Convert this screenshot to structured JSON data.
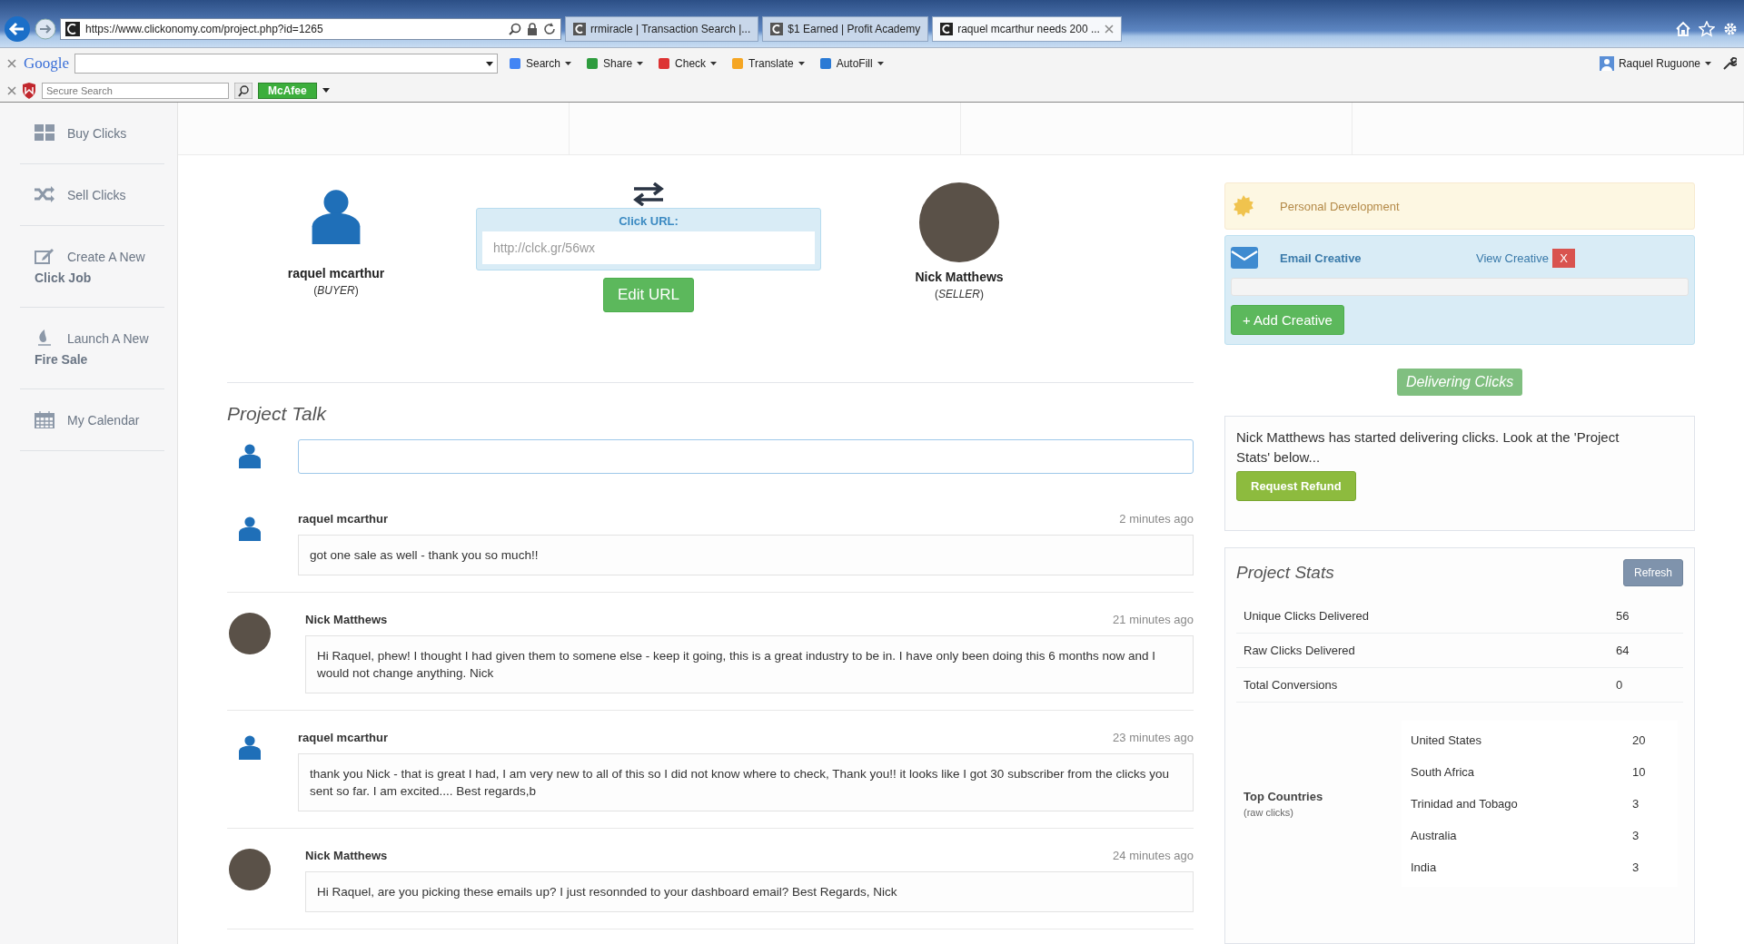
{
  "browser": {
    "url": "https://www.clickonomy.com/project.php?id=1265",
    "tabs": [
      {
        "title": "rrmiracle | Transaction Search |...",
        "selected": false
      },
      {
        "title": "$1 Earned | Profit Academy",
        "selected": false
      },
      {
        "title": "raquel mcarthur needs 200 ...",
        "selected": true
      }
    ],
    "toolbar": {
      "brand": "Google",
      "buttons": [
        "Search",
        "Share",
        "Check",
        "Translate",
        "AutoFill"
      ],
      "user": "Raquel Ruguone"
    },
    "security_bar": {
      "placeholder": "Secure Search",
      "badge": "McAfee"
    }
  },
  "sidebar": {
    "items": [
      {
        "kind": "grid",
        "label": "Buy Clicks"
      },
      {
        "kind": "shuffle",
        "label": "Sell Clicks"
      },
      {
        "kind": "edit",
        "label": "Create A New",
        "sub": "Click Job"
      },
      {
        "kind": "flame",
        "label": "Launch A New",
        "sub": "Fire Sale"
      },
      {
        "kind": "calendar",
        "label": "My Calendar"
      }
    ]
  },
  "parties": {
    "buyer": {
      "name": "raquel mcarthur",
      "role": "(*BUYER*)"
    },
    "click_url": {
      "label": "Click URL:",
      "placeholder": "http://clck.gr/56wx",
      "button": "Edit URL"
    },
    "seller": {
      "name": "Nick Matthews",
      "role": "(*SELLER*)"
    }
  },
  "talk": {
    "title": "Project Talk",
    "messages": [
      {
        "kind": "buyer",
        "author": "raquel mcarthur",
        "time": "2 minutes ago",
        "text": "got one sale as well - thank you so much!!"
      },
      {
        "kind": "seller",
        "author": "Nick Matthews",
        "time": "21 minutes ago",
        "text": "Hi Raquel, phew! I thought I had given them to somene else - keep it going, this is a great industry to be in. I have only been doing this 6 months now and I would not change anything. Nick"
      },
      {
        "kind": "buyer",
        "author": "raquel mcarthur",
        "time": "23 minutes ago",
        "text": "thank you Nick - that is great I had, I am very new to all of this so I did not know where to check, Thank you!! it looks like I got 30 subscriber from the clicks you sent so far. I am excited.... Best regards,b"
      },
      {
        "kind": "seller",
        "author": "Nick Matthews",
        "time": "24 minutes ago",
        "text": "Hi Raquel, are you picking these emails up? I just resonnded to your dashboard email? Best Regards, Nick"
      }
    ]
  },
  "category": {
    "label": "Personal Development"
  },
  "creative": {
    "title": "Email Creative",
    "link": "View Creative",
    "remove": "X",
    "add_button": "+ Add Creative"
  },
  "status": {
    "label": "Delivering Clicks"
  },
  "notice": {
    "text": "Nick Matthews has started delivering clicks. Look at the 'Project Stats' below...",
    "button": "Request Refund"
  },
  "stats": {
    "title": "Project Stats",
    "refresh": "Refresh",
    "rows": [
      {
        "label": "Unique Clicks Delivered",
        "value": "56"
      },
      {
        "label": "Raw Clicks Delivered",
        "value": "64"
      },
      {
        "label": "Total Conversions",
        "value": "0"
      }
    ],
    "countries_label": "Top Countries",
    "countries_note": "(raw clicks)",
    "countries": [
      {
        "name": "United States",
        "value": "20"
      },
      {
        "name": "South Africa",
        "value": "10"
      },
      {
        "name": "Trinidad and Tobago",
        "value": "3"
      },
      {
        "name": "Australia",
        "value": "3"
      },
      {
        "name": "India",
        "value": "3"
      }
    ]
  }
}
